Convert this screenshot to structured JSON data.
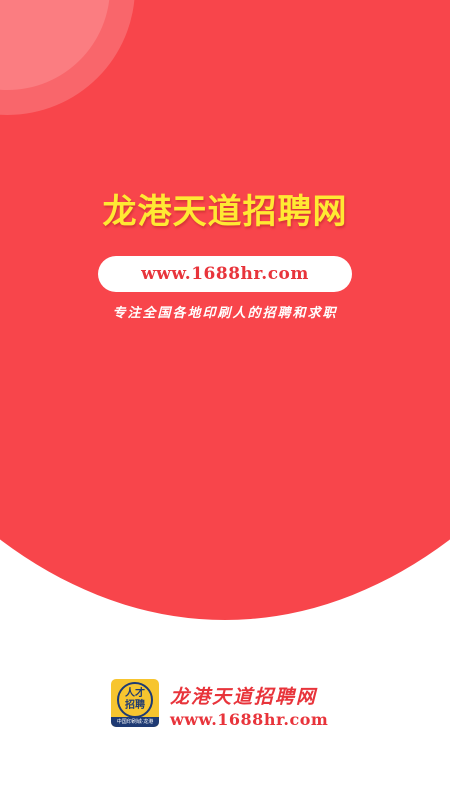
{
  "hero": {
    "title": "龙港天道招聘网",
    "url": "www.1688hr.com",
    "slogan": "专注全国各地印刷人的招聘和求职"
  },
  "footer": {
    "logo": {
      "line1": "人才",
      "line2": "招聘",
      "band": "中国印刷城·龙港",
      "icon": "talent-recruitment-logo"
    },
    "brand_name": "龙港天道招聘网",
    "brand_url": "www.1688hr.com"
  },
  "colors": {
    "primary_red": "#f8454b",
    "title_yellow": "#ffe933",
    "logo_yellow": "#f7c52f",
    "logo_navy": "#1e3a73",
    "text_red": "#e8343b"
  }
}
